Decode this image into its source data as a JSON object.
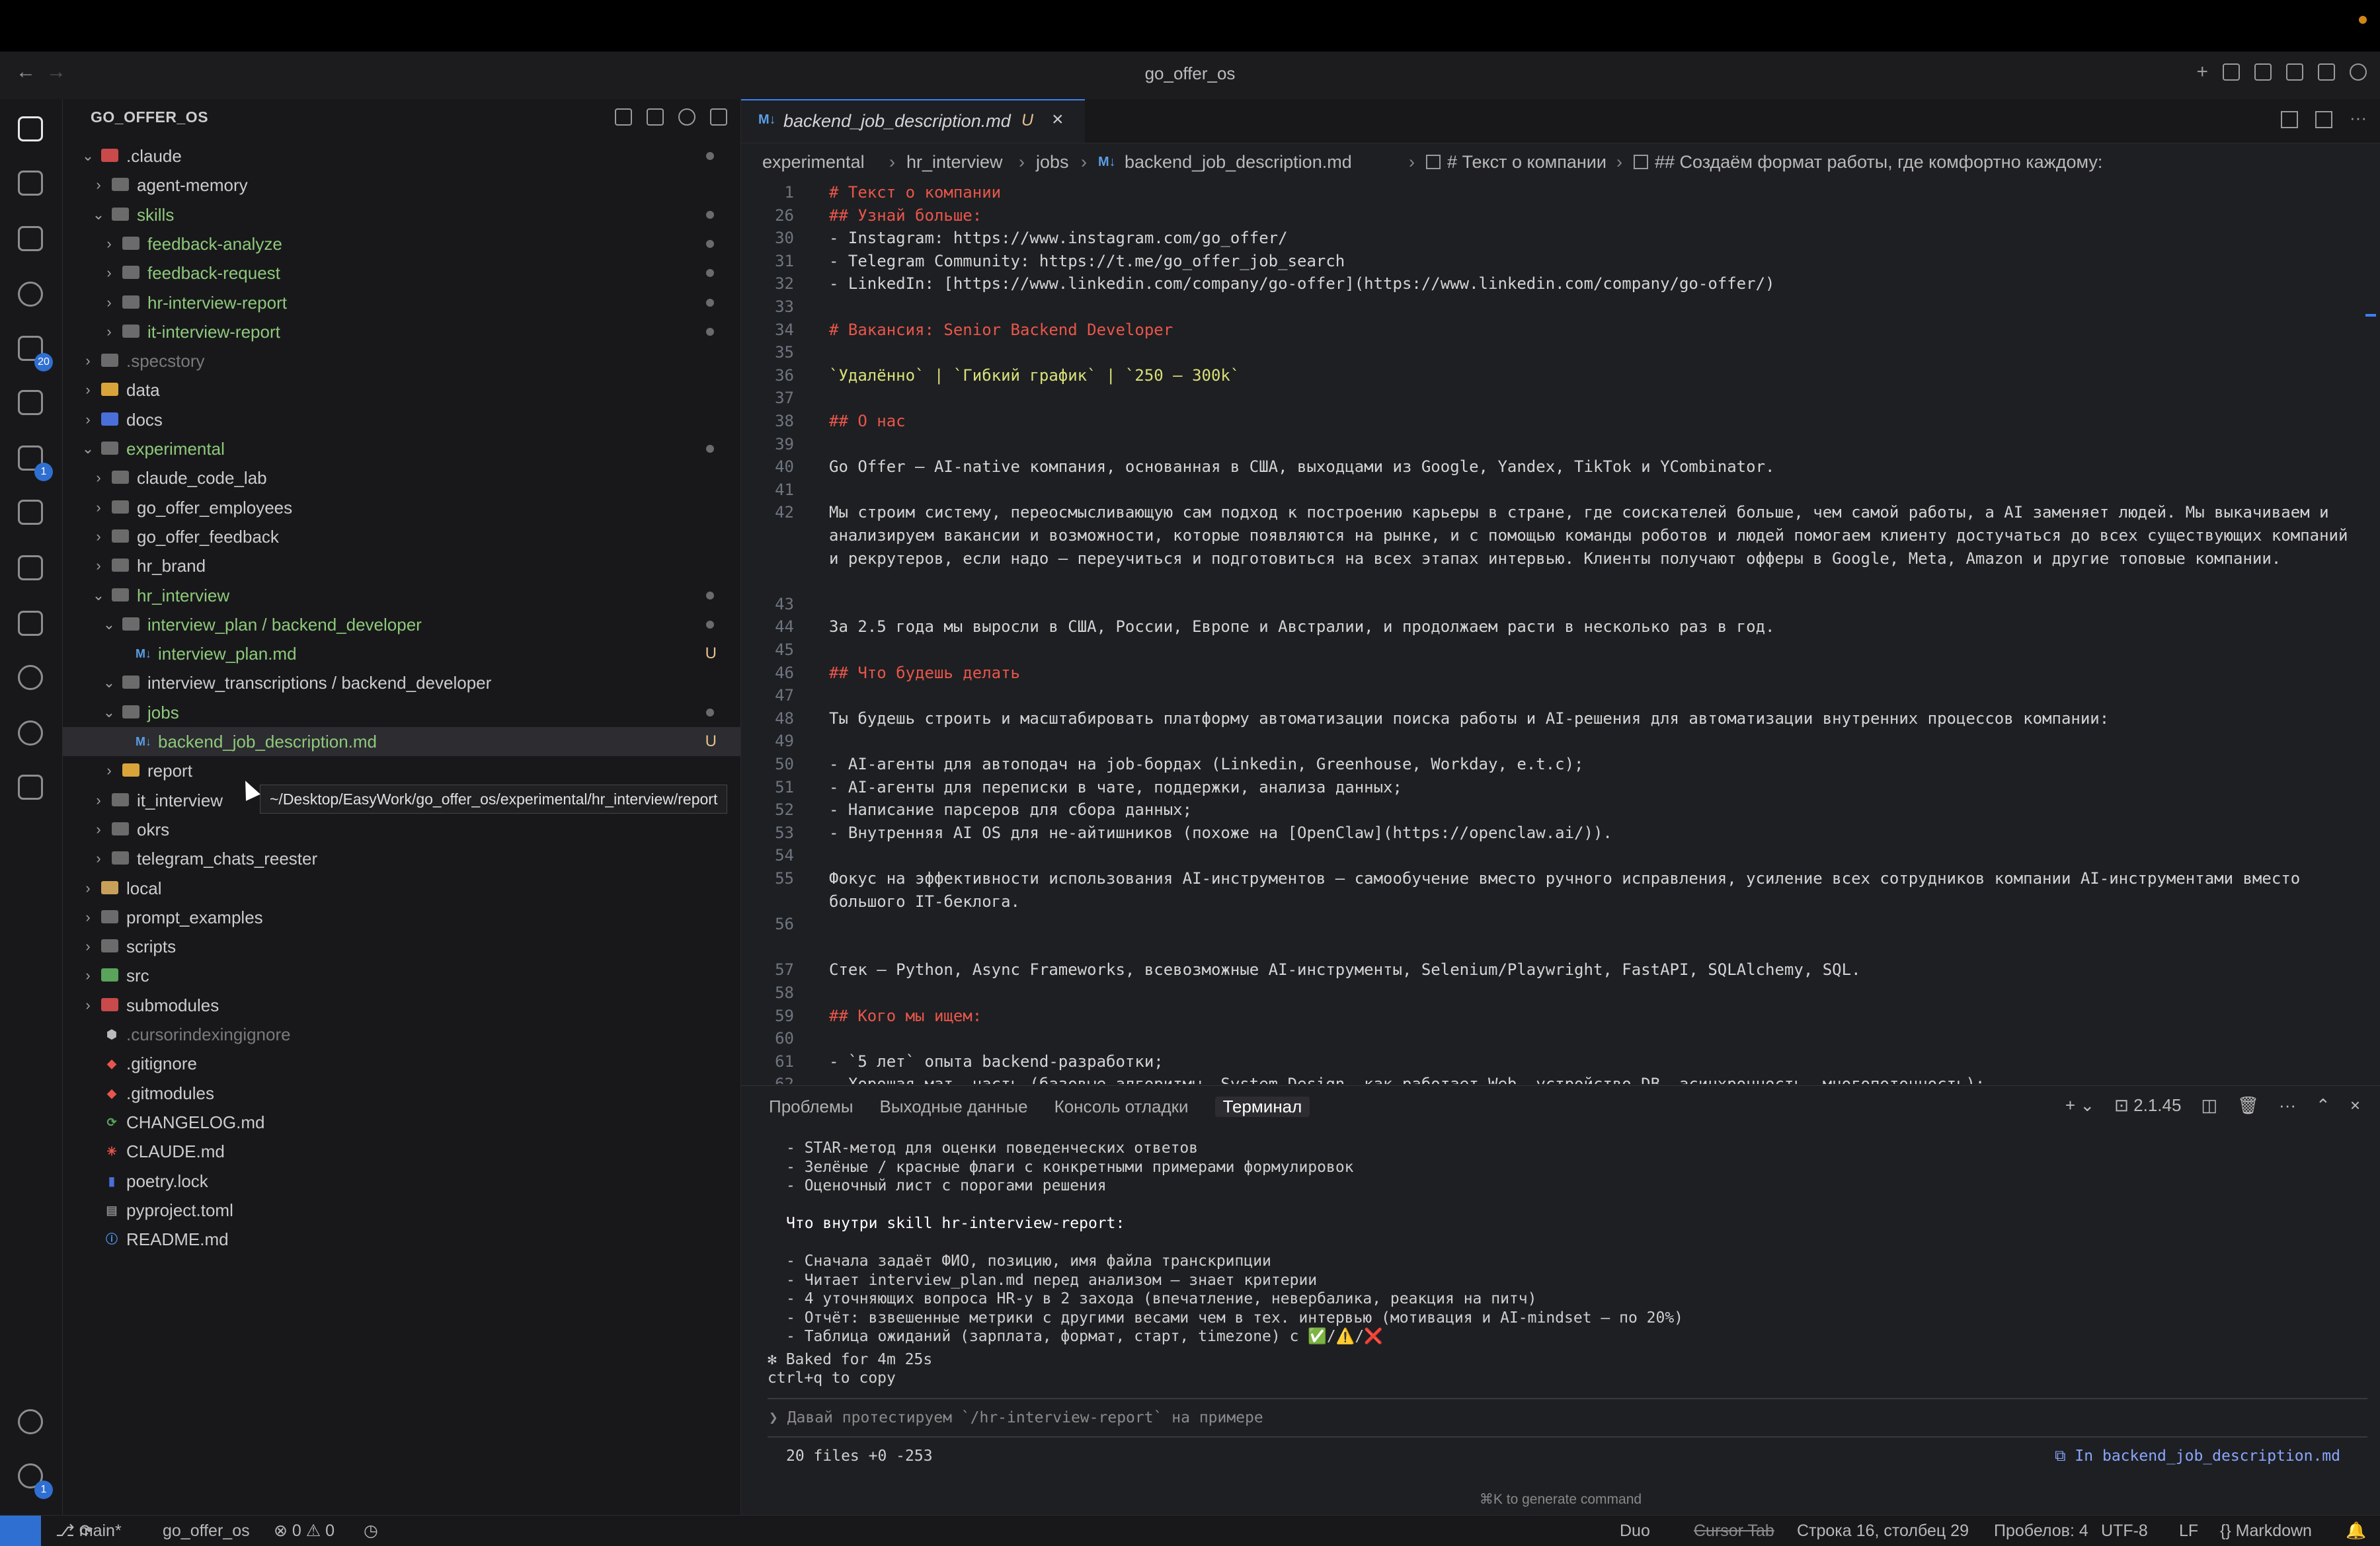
{
  "window": {
    "title": "go_offer_os"
  },
  "explorer": {
    "header": "GO_OFFER_OS",
    "rows": [
      {
        "label": ".claude",
        "kind": "folder",
        "open": true
      },
      {
        "label": "agent-memory",
        "kind": "folder"
      },
      {
        "label": "skills",
        "kind": "folder",
        "open": true
      },
      {
        "label": "feedback-analyze",
        "kind": "folder"
      },
      {
        "label": "feedback-request",
        "kind": "folder"
      },
      {
        "label": "hr-interview-report",
        "kind": "folder"
      },
      {
        "label": "it-interview-report",
        "kind": "folder"
      },
      {
        "label": ".specstory",
        "kind": "folder"
      },
      {
        "label": "data",
        "kind": "folder"
      },
      {
        "label": "docs",
        "kind": "folder"
      },
      {
        "label": "experimental",
        "kind": "folder",
        "open": true
      },
      {
        "label": "claude_code_lab",
        "kind": "folder"
      },
      {
        "label": "go_offer_employees",
        "kind": "folder"
      },
      {
        "label": "go_offer_feedback",
        "kind": "folder"
      },
      {
        "label": "hr_brand",
        "kind": "folder"
      },
      {
        "label": "hr_interview",
        "kind": "folder",
        "open": true
      },
      {
        "label": "interview_plan / backend_developer",
        "kind": "folder",
        "open": true
      },
      {
        "label": "interview_plan.md",
        "kind": "md",
        "status": "U"
      },
      {
        "label": "interview_transcriptions / backend_developer",
        "kind": "folder",
        "open": true
      },
      {
        "label": "jobs",
        "kind": "folder",
        "open": true
      },
      {
        "label": "backend_job_description.md",
        "kind": "md",
        "status": "U"
      },
      {
        "label": "report",
        "kind": "folder"
      },
      {
        "label": "it_interview",
        "kind": "folder"
      },
      {
        "label": "okrs",
        "kind": "folder"
      },
      {
        "label": "telegram_chats_reester",
        "kind": "folder"
      },
      {
        "label": "local",
        "kind": "folder"
      },
      {
        "label": "prompt_examples",
        "kind": "folder"
      },
      {
        "label": "scripts",
        "kind": "folder"
      },
      {
        "label": "src",
        "kind": "folder"
      },
      {
        "label": "submodules",
        "kind": "folder"
      },
      {
        "label": ".cursorindexingignore",
        "kind": "file"
      },
      {
        "label": ".gitignore",
        "kind": "file"
      },
      {
        "label": ".gitmodules",
        "kind": "file"
      },
      {
        "label": "CHANGELOG.md",
        "kind": "file"
      },
      {
        "label": "CLAUDE.md",
        "kind": "file"
      },
      {
        "label": "poetry.lock",
        "kind": "file"
      },
      {
        "label": "pyproject.toml",
        "kind": "file"
      },
      {
        "label": "README.md",
        "kind": "file"
      }
    ],
    "tooltip": "~/Desktop/EasyWork/go_offer_os/experimental/hr_interview/report"
  },
  "activity_badges": {
    "source_control": "20",
    "extensions": "1",
    "settings": "1"
  },
  "tab": {
    "name": "backend_job_description.md",
    "status": "U",
    "icon": "M↓"
  },
  "breadcrumb": [
    "experimental",
    "hr_interview",
    "jobs",
    "backend_job_description.md",
    "# Текст о компании",
    "## Создаём формат работы, где комфортно каждому:"
  ],
  "editor_lines": [
    {
      "n": "1",
      "t": "# Текст о компании",
      "k": "h"
    },
    {
      "n": "26",
      "t": "## Узнай больше:",
      "k": "h"
    },
    {
      "n": "30",
      "t": "- Instagram: https://www.instagram.com/go_offer/",
      "k": "p"
    },
    {
      "n": "31",
      "t": "- Telegram Community: https://t.me/go_offer_job_search",
      "k": "p"
    },
    {
      "n": "32",
      "t": "- LinkedIn: [https://www.linkedin.com/company/go-offer](https://www.linkedin.com/company/go-offer/)",
      "k": "p"
    },
    {
      "n": "33",
      "t": "",
      "k": "p"
    },
    {
      "n": "34",
      "t": "# Вакансия: Senior Backend Developer",
      "k": "h"
    },
    {
      "n": "35",
      "t": "",
      "k": "p"
    },
    {
      "n": "36",
      "t": "`Удалённо` | `Гибкий график` | `250 – 300k`",
      "k": "t"
    },
    {
      "n": "37",
      "t": "",
      "k": "p"
    },
    {
      "n": "38",
      "t": "## О нас",
      "k": "h"
    },
    {
      "n": "39",
      "t": "",
      "k": "p"
    },
    {
      "n": "40",
      "t": "Go Offer — AI-native компания, основанная  в США, выходцами из Google, Yandex, TikTok и YCombinator.",
      "k": "p"
    },
    {
      "n": "41",
      "t": "",
      "k": "p"
    },
    {
      "n": "42",
      "t": "Мы строим систему, переосмысливающую сам подход к построению карьеры в стране, где соискателей больше, чем самой работы, а AI заменяет людей. Мы выкачиваем и",
      "k": "p"
    },
    {
      "n": "",
      "t": "анализируем вакансии и возможности, которые появляются на рынке, и с помощью команды роботов и людей помогаем клиенту достучаться до всех существующих компаний",
      "k": "p"
    },
    {
      "n": "",
      "t": "и рекрутеров, если надо — переучиться и подготовиться на всех этапах интервью. Клиенты получают офферы в Google, Meta, Amazon и другие топовые компании.",
      "k": "p"
    },
    {
      "n": "43",
      "t": "",
      "k": "p"
    },
    {
      "n": "44",
      "t": "За 2.5 года мы выросли в США, России, Европе и Австралии, и продолжаем расти в несколько раз в год.",
      "k": "p"
    },
    {
      "n": "45",
      "t": "",
      "k": "p"
    },
    {
      "n": "46",
      "t": "## Что будешь делать",
      "k": "h"
    },
    {
      "n": "47",
      "t": "",
      "k": "p"
    },
    {
      "n": "48",
      "t": "Ты будешь строить и масштабировать платформу автоматизации поиска работы и AI-решения для автоматизации внутренних процессов компании:",
      "k": "p"
    },
    {
      "n": "49",
      "t": "",
      "k": "p"
    },
    {
      "n": "50",
      "t": "- AI-агенты для автоподач на job-бордах (Linkedin, Greenhouse, Workday, e.t.c);",
      "k": "p"
    },
    {
      "n": "51",
      "t": "- AI-агенты для переписки в чате, поддержки, анализа данных;",
      "k": "p"
    },
    {
      "n": "52",
      "t": "- Написание парсеров для сбора данных;",
      "k": "p"
    },
    {
      "n": "53",
      "t": "- Внутренняя AI OS для не-айтишников (похоже на [OpenClaw](https://openclaw.ai/)).",
      "k": "p"
    },
    {
      "n": "54",
      "t": "",
      "k": "p"
    },
    {
      "n": "55",
      "t": "Фокус на эффективности использования AI-инструментов – самообучение вместо ручного исправления, усиление всех сотрудников компании AI-инструментами вместо",
      "k": "p"
    },
    {
      "n": "",
      "t": "большого IT-беклога.",
      "k": "p"
    },
    {
      "n": "56",
      "t": "",
      "k": "p"
    },
    {
      "n": "57",
      "t": "Стек – Python, Async Frameworks, всевозможные AI-инструменты, Selenium/Playwright, FastAPI, SQLAlchemy, SQL.",
      "k": "p"
    },
    {
      "n": "58",
      "t": "",
      "k": "p"
    },
    {
      "n": "59",
      "t": "## Кого мы ищем:",
      "k": "h"
    },
    {
      "n": "60",
      "t": "",
      "k": "p"
    },
    {
      "n": "61",
      "t": "- `5 лет` опыта backend-разработки;",
      "k": "p"
    },
    {
      "n": "62",
      "t": "- Хорошая мат. часть (базовые алгоритмы, System Design, как работает Web, устройство DB, асинхронность, многопоточность);",
      "k": "p"
    }
  ],
  "panel": {
    "tabs": [
      "Проблемы",
      "Выходные данные",
      "Консоль отладки",
      "Терминал"
    ],
    "version": "2.1.45",
    "terminal_lines": [
      "- STAR-метод для оценки поведенческих ответов",
      "- Зелёные / красные флаги с конкретными примерами формулировок",
      "- Оценочный лист с порогами решения",
      "",
      "Что внутри skill hr-interview-report:",
      "",
      "- Сначала задаёт ФИО, позицию, имя файла транскрипции",
      "- Читает interview_plan.md перед анализом — знает критерии",
      "- 4 уточняющих вопроса HR-у в 2 захода (впечатление, невербалика, реакция на питч)",
      "- Отчёт: взвешенные метрики с другими весами чем в тех. интервью (мотивация и AI-mindset — по 20%)",
      "- Таблица ожиданий (зарплата, формат, старт, timezone) с ✅/⚠️/❌"
    ],
    "baked": "✻ Baked for 4m 25s",
    "copy_hint": "ctrl+q to copy",
    "prompt": "❯ Давай протестируем `/hr-interview-report` на примере",
    "files_summary": "20 files +0 -253",
    "context": "⧉ In backend_job_description.md",
    "generate_hint": "⌘K to generate command"
  },
  "statusbar": {
    "branch": "main*",
    "project": "go_offer_os",
    "problems": "⊗ 0 ⚠ 0",
    "duo": "Duo",
    "cursor_tab": "Cursor Tab",
    "position": "Строка 16, столбец 29",
    "spaces": "Пробелов: 4",
    "encoding": "UTF-8",
    "eol": "LF",
    "language": "{} Markdown"
  },
  "colors": {
    "accent": "#3b82f6",
    "heading": "#e8564b",
    "untracked": "#e2c08d",
    "folder": "#c9a05a"
  }
}
